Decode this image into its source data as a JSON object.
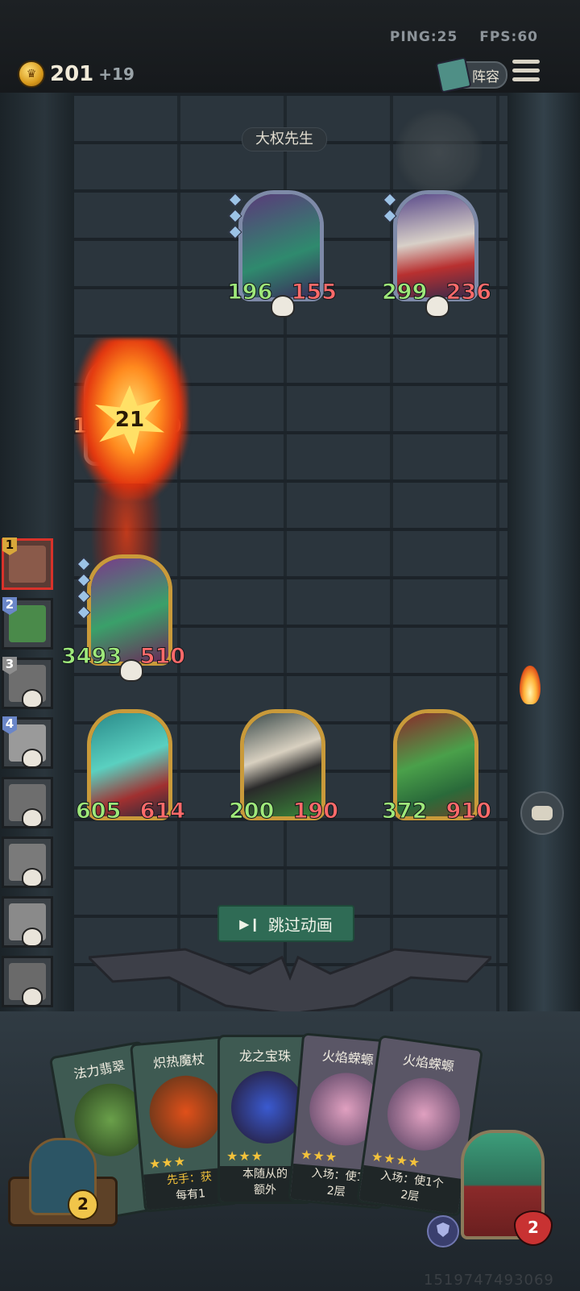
{
  "status": {
    "ping": "PING:25",
    "fps": "FPS:60"
  },
  "gold": {
    "amount": "201",
    "income": "+19"
  },
  "lineup_button": "阵容",
  "opponent": {
    "name": "大权先生"
  },
  "damage_burst": "21",
  "enemy_minions": [
    {
      "attack": "196",
      "health": "155"
    },
    {
      "attack": "299",
      "health": "236"
    }
  ],
  "attacking_minion": {
    "attack": "3493",
    "health": "510"
  },
  "burning_minion": {
    "attack": "1",
    "health": "0"
  },
  "player_minions": [
    {
      "attack": "605",
      "health": "614"
    },
    {
      "attack": "200",
      "health": "190"
    },
    {
      "attack": "372",
      "health": "910"
    }
  ],
  "turn_order": [
    "1",
    "2",
    "3",
    "4"
  ],
  "skip_button": "跳过动画",
  "hand": [
    {
      "title": "法力翡翠",
      "text1": "",
      "text2": ""
    },
    {
      "title": "炽热魔杖",
      "text1": "先手：获",
      "text2": "每有1"
    },
    {
      "title": "龙之宝珠",
      "text1": "本随从的",
      "text2": "额外"
    },
    {
      "title": "火焰蝾螈",
      "text1": "入场：使1",
      "text2": "2层"
    },
    {
      "title": "火焰蝾螈",
      "text1": "入场：使1个",
      "text2": "2层"
    }
  ],
  "reroll_cost": "2",
  "hero_life": "2",
  "uid": "1519747493069"
}
